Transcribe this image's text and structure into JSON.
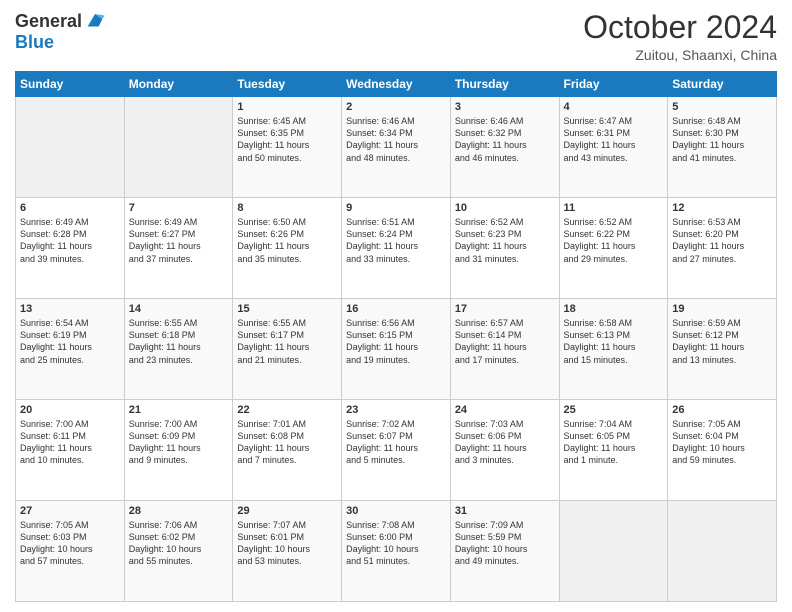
{
  "header": {
    "logo_general": "General",
    "logo_blue": "Blue",
    "title": "October 2024",
    "subtitle": "Zuitou, Shaanxi, China"
  },
  "calendar": {
    "weekdays": [
      "Sunday",
      "Monday",
      "Tuesday",
      "Wednesday",
      "Thursday",
      "Friday",
      "Saturday"
    ],
    "weeks": [
      [
        {
          "day": "",
          "info": ""
        },
        {
          "day": "",
          "info": ""
        },
        {
          "day": "1",
          "info": "Sunrise: 6:45 AM\nSunset: 6:35 PM\nDaylight: 11 hours\nand 50 minutes."
        },
        {
          "day": "2",
          "info": "Sunrise: 6:46 AM\nSunset: 6:34 PM\nDaylight: 11 hours\nand 48 minutes."
        },
        {
          "day": "3",
          "info": "Sunrise: 6:46 AM\nSunset: 6:32 PM\nDaylight: 11 hours\nand 46 minutes."
        },
        {
          "day": "4",
          "info": "Sunrise: 6:47 AM\nSunset: 6:31 PM\nDaylight: 11 hours\nand 43 minutes."
        },
        {
          "day": "5",
          "info": "Sunrise: 6:48 AM\nSunset: 6:30 PM\nDaylight: 11 hours\nand 41 minutes."
        }
      ],
      [
        {
          "day": "6",
          "info": "Sunrise: 6:49 AM\nSunset: 6:28 PM\nDaylight: 11 hours\nand 39 minutes."
        },
        {
          "day": "7",
          "info": "Sunrise: 6:49 AM\nSunset: 6:27 PM\nDaylight: 11 hours\nand 37 minutes."
        },
        {
          "day": "8",
          "info": "Sunrise: 6:50 AM\nSunset: 6:26 PM\nDaylight: 11 hours\nand 35 minutes."
        },
        {
          "day": "9",
          "info": "Sunrise: 6:51 AM\nSunset: 6:24 PM\nDaylight: 11 hours\nand 33 minutes."
        },
        {
          "day": "10",
          "info": "Sunrise: 6:52 AM\nSunset: 6:23 PM\nDaylight: 11 hours\nand 31 minutes."
        },
        {
          "day": "11",
          "info": "Sunrise: 6:52 AM\nSunset: 6:22 PM\nDaylight: 11 hours\nand 29 minutes."
        },
        {
          "day": "12",
          "info": "Sunrise: 6:53 AM\nSunset: 6:20 PM\nDaylight: 11 hours\nand 27 minutes."
        }
      ],
      [
        {
          "day": "13",
          "info": "Sunrise: 6:54 AM\nSunset: 6:19 PM\nDaylight: 11 hours\nand 25 minutes."
        },
        {
          "day": "14",
          "info": "Sunrise: 6:55 AM\nSunset: 6:18 PM\nDaylight: 11 hours\nand 23 minutes."
        },
        {
          "day": "15",
          "info": "Sunrise: 6:55 AM\nSunset: 6:17 PM\nDaylight: 11 hours\nand 21 minutes."
        },
        {
          "day": "16",
          "info": "Sunrise: 6:56 AM\nSunset: 6:15 PM\nDaylight: 11 hours\nand 19 minutes."
        },
        {
          "day": "17",
          "info": "Sunrise: 6:57 AM\nSunset: 6:14 PM\nDaylight: 11 hours\nand 17 minutes."
        },
        {
          "day": "18",
          "info": "Sunrise: 6:58 AM\nSunset: 6:13 PM\nDaylight: 11 hours\nand 15 minutes."
        },
        {
          "day": "19",
          "info": "Sunrise: 6:59 AM\nSunset: 6:12 PM\nDaylight: 11 hours\nand 13 minutes."
        }
      ],
      [
        {
          "day": "20",
          "info": "Sunrise: 7:00 AM\nSunset: 6:11 PM\nDaylight: 11 hours\nand 10 minutes."
        },
        {
          "day": "21",
          "info": "Sunrise: 7:00 AM\nSunset: 6:09 PM\nDaylight: 11 hours\nand 9 minutes."
        },
        {
          "day": "22",
          "info": "Sunrise: 7:01 AM\nSunset: 6:08 PM\nDaylight: 11 hours\nand 7 minutes."
        },
        {
          "day": "23",
          "info": "Sunrise: 7:02 AM\nSunset: 6:07 PM\nDaylight: 11 hours\nand 5 minutes."
        },
        {
          "day": "24",
          "info": "Sunrise: 7:03 AM\nSunset: 6:06 PM\nDaylight: 11 hours\nand 3 minutes."
        },
        {
          "day": "25",
          "info": "Sunrise: 7:04 AM\nSunset: 6:05 PM\nDaylight: 11 hours\nand 1 minute."
        },
        {
          "day": "26",
          "info": "Sunrise: 7:05 AM\nSunset: 6:04 PM\nDaylight: 10 hours\nand 59 minutes."
        }
      ],
      [
        {
          "day": "27",
          "info": "Sunrise: 7:05 AM\nSunset: 6:03 PM\nDaylight: 10 hours\nand 57 minutes."
        },
        {
          "day": "28",
          "info": "Sunrise: 7:06 AM\nSunset: 6:02 PM\nDaylight: 10 hours\nand 55 minutes."
        },
        {
          "day": "29",
          "info": "Sunrise: 7:07 AM\nSunset: 6:01 PM\nDaylight: 10 hours\nand 53 minutes."
        },
        {
          "day": "30",
          "info": "Sunrise: 7:08 AM\nSunset: 6:00 PM\nDaylight: 10 hours\nand 51 minutes."
        },
        {
          "day": "31",
          "info": "Sunrise: 7:09 AM\nSunset: 5:59 PM\nDaylight: 10 hours\nand 49 minutes."
        },
        {
          "day": "",
          "info": ""
        },
        {
          "day": "",
          "info": ""
        }
      ]
    ]
  }
}
